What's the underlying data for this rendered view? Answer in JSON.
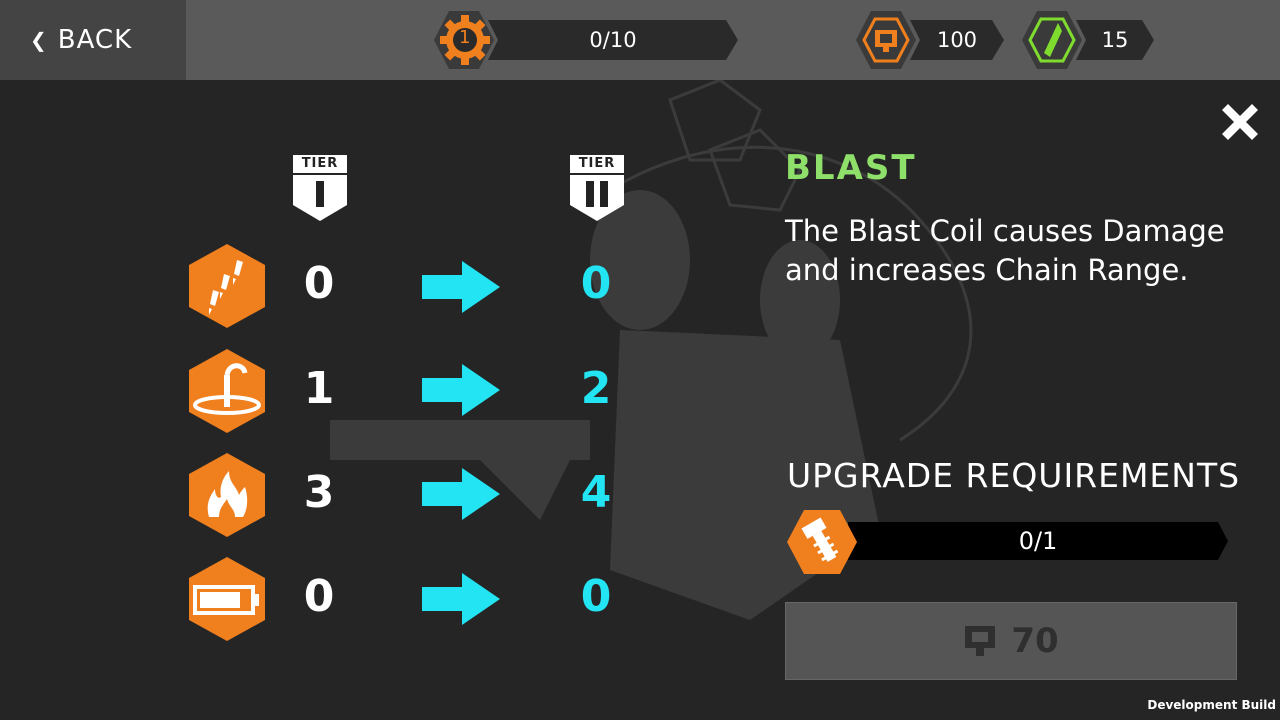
{
  "topbar": {
    "back_label": "BACK",
    "level_value": "1",
    "level_progress": "0/10",
    "coins_value": "100",
    "gems_value": "15"
  },
  "tiers": {
    "left_label": "TIER",
    "right_label": "TIER"
  },
  "stats": [
    {
      "icon": "rockets-icon",
      "current": "0",
      "next": "0"
    },
    {
      "icon": "ground-impact-icon",
      "current": "1",
      "next": "2"
    },
    {
      "icon": "fire-icon",
      "current": "3",
      "next": "4"
    },
    {
      "icon": "battery-icon",
      "current": "0",
      "next": "0"
    }
  ],
  "panel": {
    "title": "BLAST",
    "description": "The Blast Coil causes Damage and increases Chain Range.",
    "requirements_title": "UPGRADE REQUIREMENTS",
    "requirement_progress": "0/1",
    "upgrade_cost": "70"
  },
  "footer": {
    "dev_build": "Development Build"
  },
  "colors": {
    "accent_orange": "#f07f1e",
    "accent_cyan": "#22e4f2",
    "title_green": "#8fe06a",
    "gem_green": "#7fdc2f"
  }
}
